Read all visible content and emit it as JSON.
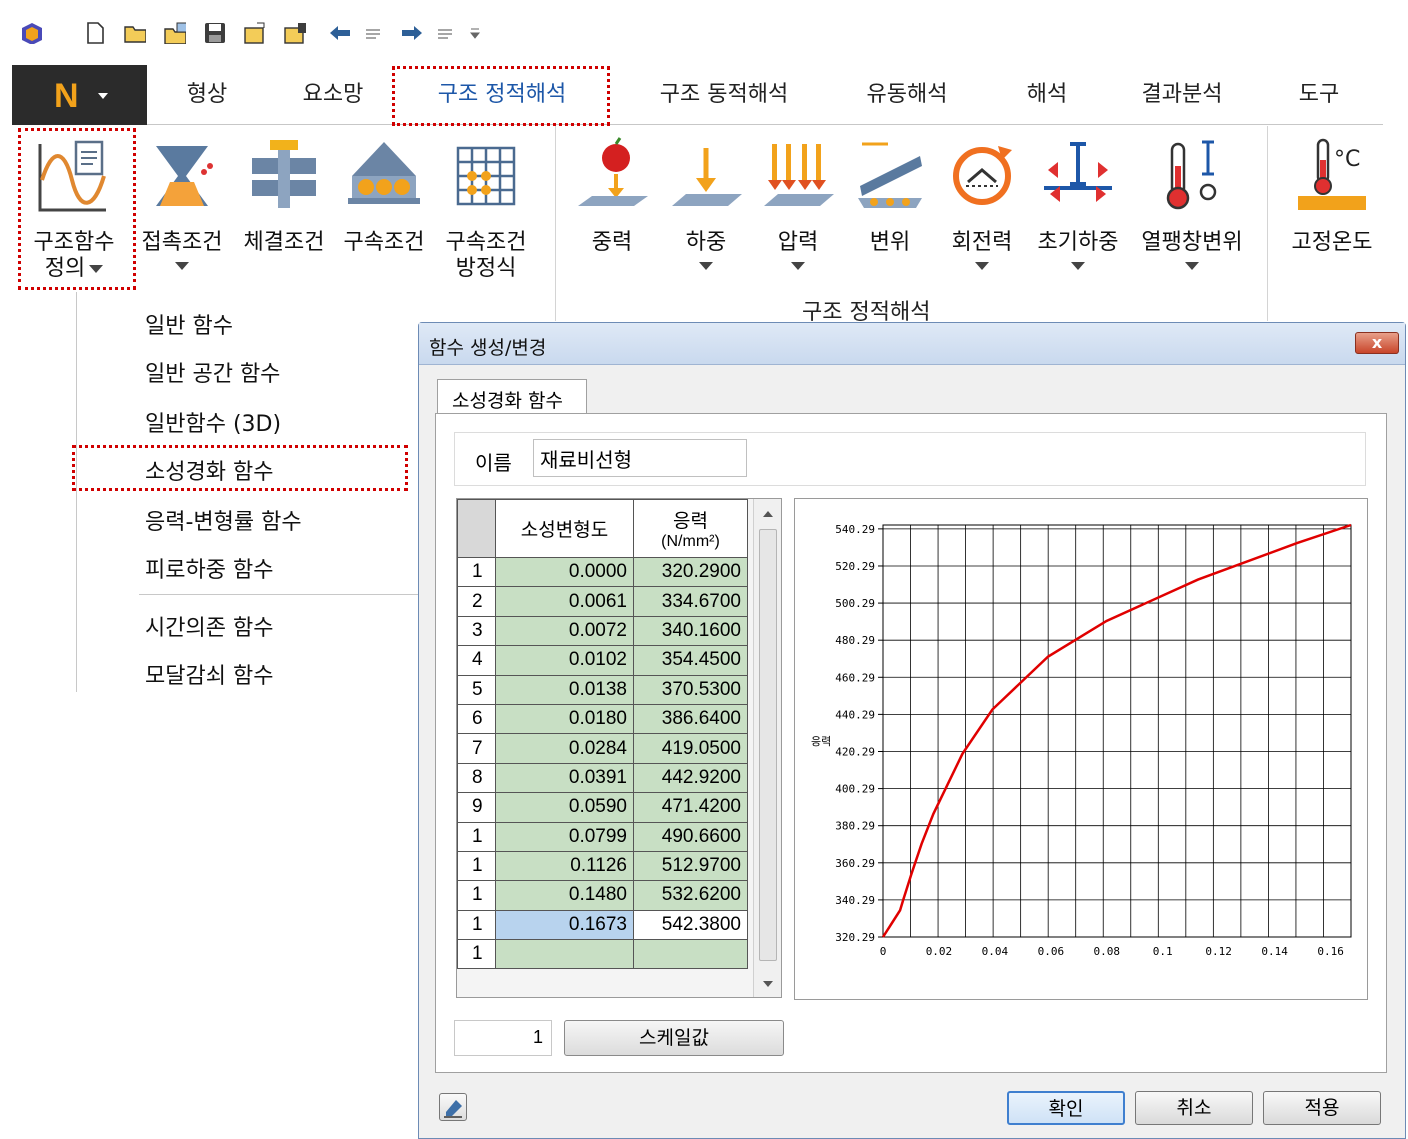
{
  "ribbon_tabs": [
    "형상",
    "요소망",
    "구조 정적해석",
    "구조 동적해석",
    "유동해석",
    "해석",
    "결과분석",
    "도구"
  ],
  "ribbon_buttons": {
    "func_def": [
      "구조함수",
      "정의"
    ],
    "contact": "접촉조건",
    "fasten": "체결조건",
    "constraint": "구속조건",
    "constraint_eq": [
      "구속조건",
      "방정식"
    ],
    "gravity": "중력",
    "load": "하중",
    "pressure": "압력",
    "displacement": "변위",
    "rot_force": "회전력",
    "init_load": "초기하중",
    "thermal": "열팽창변위",
    "fixed_temp": "고정온도"
  },
  "ribbon_group_label": "구조 정적해석",
  "menu": {
    "items": [
      "일반 함수",
      "일반 공간 함수",
      "일반함수 (3D)",
      "소성경화 함수",
      "응력-변형률 함수",
      "피로하중 함수",
      "시간의존 함수",
      "모달감쇠 함수"
    ]
  },
  "dialog": {
    "title": "함수 생성/변경",
    "close": "x",
    "tab": "소성경화 함수",
    "name_label": "이름",
    "name_value": "재료비선형",
    "col_strain": "소성변형도",
    "col_stress_1": "응력",
    "col_stress_2": "(N/mm²)",
    "rows": [
      [
        "1",
        "0.0000",
        "320.2900"
      ],
      [
        "2",
        "0.0061",
        "334.6700"
      ],
      [
        "3",
        "0.0072",
        "340.1600"
      ],
      [
        "4",
        "0.0102",
        "354.4500"
      ],
      [
        "5",
        "0.0138",
        "370.5300"
      ],
      [
        "6",
        "0.0180",
        "386.6400"
      ],
      [
        "7",
        "0.0284",
        "419.0500"
      ],
      [
        "8",
        "0.0391",
        "442.9200"
      ],
      [
        "9",
        "0.0590",
        "471.4200"
      ],
      [
        "1",
        "0.0799",
        "490.6600"
      ],
      [
        "1",
        "0.1126",
        "512.9700"
      ],
      [
        "1",
        "0.1480",
        "532.6200"
      ],
      [
        "1",
        "0.1673",
        "542.3800"
      ],
      [
        "1",
        "",
        ""
      ]
    ],
    "scale_value": "1",
    "scale_button": "스케일값",
    "ok": "확인",
    "cancel": "취소",
    "apply": "적용"
  },
  "chart_data": {
    "type": "line",
    "ylabel": "응력",
    "x_ticks": [
      "0",
      "0.02",
      "0.04",
      "0.06",
      "0.08",
      "0.1",
      "0.12",
      "0.14",
      "0.16"
    ],
    "y_ticks": [
      "320.29",
      "340.29",
      "360.29",
      "380.29",
      "400.29",
      "420.29",
      "440.29",
      "460.29",
      "480.29",
      "500.29",
      "520.29",
      "540.29"
    ],
    "xlim": [
      0,
      0.1673
    ],
    "ylim": [
      320.29,
      542.38
    ],
    "series_color": "#e00000",
    "x": [
      0.0,
      0.0061,
      0.0072,
      0.0102,
      0.0138,
      0.018,
      0.0284,
      0.0391,
      0.059,
      0.0799,
      0.1126,
      0.148,
      0.1673
    ],
    "y": [
      320.29,
      334.67,
      340.16,
      354.45,
      370.53,
      386.64,
      419.05,
      442.92,
      471.42,
      490.66,
      512.97,
      532.62,
      542.38
    ]
  },
  "colors": {
    "highlight_box": "#d00000",
    "grid_cell": "#c8dfc4",
    "selected_cell": "#b8d3ee"
  }
}
